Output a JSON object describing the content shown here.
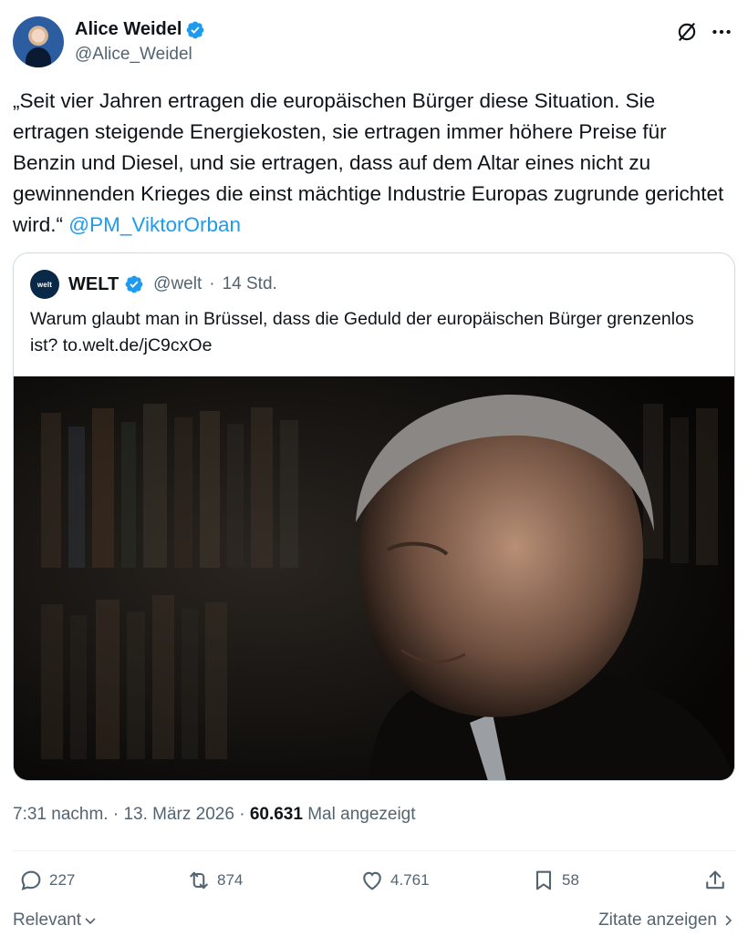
{
  "author": {
    "name": "Alice Weidel",
    "handle": "@Alice_Weidel"
  },
  "tweet": {
    "text": "„Seit vier Jahren ertragen die europäischen Bürger diese Situation. Sie ertragen steigende Energiekosten, sie ertragen immer höhere Preise für Benzin und Diesel, und sie ertragen, dass auf dem Altar eines nicht zu gewinnenden Krieges die einst mächtige Industrie Europas zugrunde gerichtet wird.“",
    "mention": "@PM_ViktorOrban"
  },
  "quote": {
    "avatar_text": "welt",
    "name": "WELT",
    "handle": "@welt",
    "separator": "·",
    "time": "14 Std.",
    "text": "Warum glaubt man in Brüssel, dass die Geduld der europäischen Bürger grenzenlos ist? to.welt.de/jC9cxOe"
  },
  "meta": {
    "time": "7:31 nachm.",
    "sep1": "·",
    "date": "13. März 2026",
    "sep2": "·",
    "views": "60.631",
    "views_label": "Mal angezeigt"
  },
  "actions": {
    "replies": "227",
    "reposts": "874",
    "likes": "4.761",
    "bookmarks": "58"
  },
  "footer": {
    "sort_label": "Relevant",
    "quotes_label": "Zitate anzeigen"
  },
  "colors": {
    "accent": "#1d9bf0",
    "secondary_text": "#536471",
    "verified_badge": "#1d9bf0"
  },
  "icons": [
    "grok-icon",
    "more-icon",
    "verified-badge-icon",
    "reply-icon",
    "repost-icon",
    "like-icon",
    "bookmark-icon",
    "share-icon",
    "chevron-down-icon",
    "chevron-right-icon"
  ]
}
